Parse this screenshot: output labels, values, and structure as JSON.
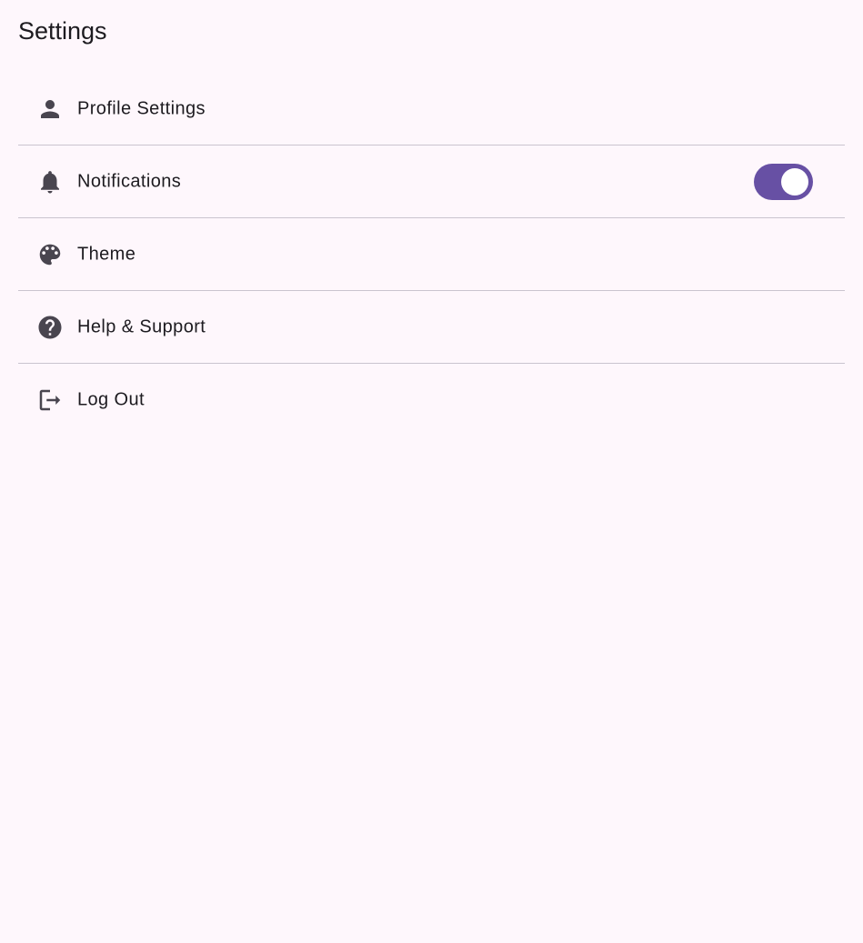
{
  "page": {
    "title": "Settings"
  },
  "settings": {
    "items": [
      {
        "label": "Profile Settings",
        "icon": "person-icon"
      },
      {
        "label": "Notifications",
        "icon": "bell-icon",
        "toggle": {
          "on": true
        }
      },
      {
        "label": "Theme",
        "icon": "palette-icon"
      },
      {
        "label": "Help & Support",
        "icon": "help-circle-icon"
      },
      {
        "label": "Log Out",
        "icon": "logout-icon"
      }
    ]
  },
  "colors": {
    "background": "#fef7fc",
    "accent": "#6750a4",
    "icon": "#49454f",
    "divider": "#cac4cf"
  }
}
